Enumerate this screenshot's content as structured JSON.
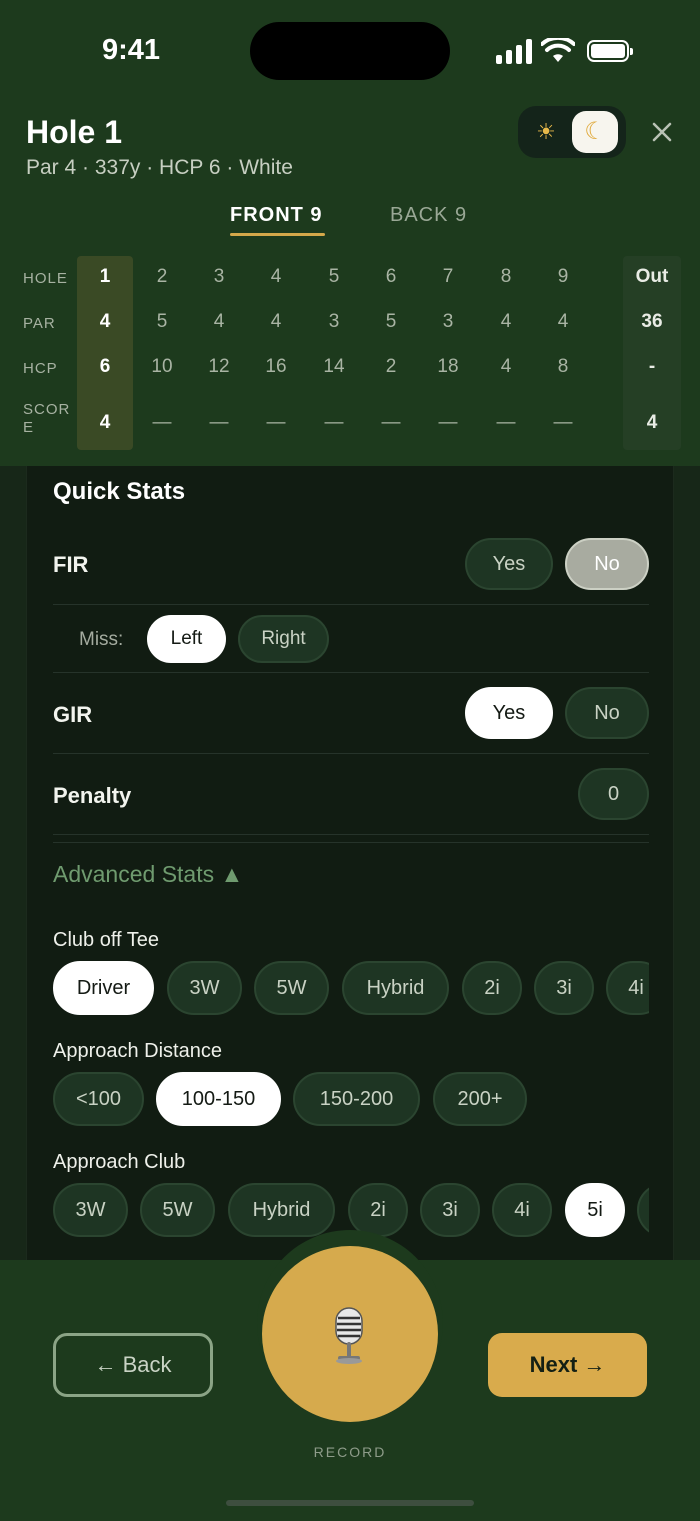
{
  "status_bar": {
    "time": "9:41"
  },
  "header": {
    "title": "Hole 1",
    "subtitle": "Par 4 · 337y · HCP 6 · White"
  },
  "tabs": [
    {
      "label": "FRONT 9",
      "active": true
    },
    {
      "label": "BACK 9",
      "active": false
    }
  ],
  "scorecard": {
    "row_labels": [
      "HOLE",
      "PAR",
      "HCP",
      "SCOR\nE"
    ],
    "holes": [
      "1",
      "2",
      "3",
      "4",
      "5",
      "6",
      "7",
      "8",
      "9"
    ],
    "par": [
      "4",
      "5",
      "4",
      "4",
      "3",
      "5",
      "3",
      "4",
      "4"
    ],
    "hcp": [
      "6",
      "10",
      "12",
      "16",
      "14",
      "2",
      "18",
      "4",
      "8"
    ],
    "score": [
      "4",
      "—",
      "—",
      "—",
      "—",
      "—",
      "—",
      "—",
      "—"
    ],
    "out": {
      "label": "Out",
      "par": "36",
      "hcp": "-",
      "score": "4"
    }
  },
  "quick_stats": {
    "title": "Quick Stats",
    "fir": {
      "label": "FIR",
      "yes": "Yes",
      "no": "No"
    },
    "miss": {
      "label": "Miss:",
      "left": "Left",
      "right": "Right"
    },
    "gir": {
      "label": "GIR",
      "yes": "Yes",
      "no": "No"
    },
    "penalty": {
      "label": "Penalty",
      "value": "0"
    }
  },
  "advanced_stats": {
    "title": "Advanced Stats ▲",
    "club_off_tee": {
      "label": "Club off Tee",
      "options": [
        "Driver",
        "3W",
        "5W",
        "Hybrid",
        "2i",
        "3i",
        "4i"
      ]
    },
    "approach_distance": {
      "label": "Approach Distance",
      "options": [
        "<100",
        "100-150",
        "150-200",
        "200+"
      ]
    },
    "approach_club": {
      "label": "Approach Club",
      "options": [
        "3W",
        "5W",
        "Hybrid",
        "2i",
        "3i",
        "4i",
        "5i"
      ]
    }
  },
  "footer": {
    "back_label": "← Back",
    "next_label": "Next →",
    "record_label": "RECORD"
  },
  "colors": {
    "background": "#1d3a1d",
    "panel": "#111c12",
    "accent_gold": "#d9ab4c",
    "advanced_green": "#6f9b6f"
  }
}
